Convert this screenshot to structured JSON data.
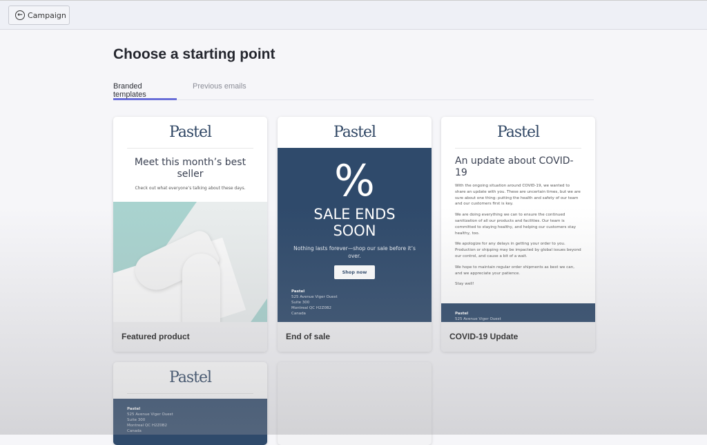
{
  "topbar": {
    "back_label": "Campaign",
    "back_icon": "arrow-left-circle-icon"
  },
  "page_title": "Choose a starting point",
  "tabs": [
    {
      "label": "Branded templates",
      "active": true
    },
    {
      "label": "Previous emails",
      "active": false
    }
  ],
  "accent": "#6a6fd8",
  "brand_navy": "#2f4a6b",
  "templates": [
    {
      "name": "Featured product",
      "logo": "Pastel",
      "headline": "Meet this month’s best seller",
      "sub": "Check out what everyone’s talking about these days."
    },
    {
      "name": "End of sale",
      "logo": "Pastel",
      "symbol": "%",
      "headline": "SALE ENDS SOON",
      "sub": "Nothing lasts forever—shop our sale before it’s over.",
      "button": "Shop now",
      "address": [
        "Pastel",
        "525 Avenue Viger Ouest",
        "Suite 300",
        "Montreal QC H2Z0B2",
        "Canada"
      ]
    },
    {
      "name": "COVID-19 Update",
      "logo": "Pastel",
      "headline": "An update about COVID-19",
      "paragraphs": [
        "With the ongoing situation around COVID-19, we wanted to share an update with you. These are uncertain times, but we are sure about one thing: putting the health and safety of our team and our customers first is key.",
        "We are doing everything we can to ensure the continued sanitization of all our products and facilities. Our team is committed to staying healthy, and helping our customers stay healthy, too.",
        "We apologize for any delays in getting your order to you. Production or shipping may be impacted by global issues beyond our control, and cause a bit of a wait.",
        "We hope to maintain regular order shipments as best we can, and we appreciate your patience.",
        "Stay well!"
      ],
      "address": [
        "Pastel",
        "525 Avenue Viger Ouest"
      ]
    },
    {
      "logo": "Pastel",
      "address": [
        "Pastel",
        "525 Avenue Viger Ouest",
        "Suite 300",
        "Montreal QC H2Z0B2",
        "Canada"
      ]
    }
  ]
}
